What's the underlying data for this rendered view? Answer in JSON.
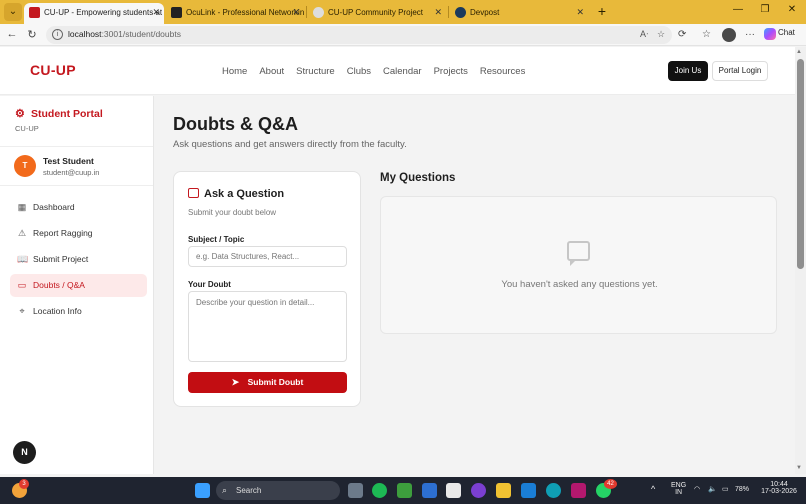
{
  "browser": {
    "tabs": [
      {
        "title": "CU-UP - Empowering students at C",
        "active": true
      },
      {
        "title": "OcuLink - Professional Networking",
        "active": false
      },
      {
        "title": "CU-UP Community Project",
        "active": false
      },
      {
        "title": "Devpost",
        "active": false
      }
    ],
    "url_host": "localhost",
    "url_path": ":3001/student/doubts",
    "chat_label": "Chat"
  },
  "site": {
    "brand": "CU-UP",
    "nav": [
      "Home",
      "About",
      "Structure",
      "Clubs",
      "Calendar",
      "Projects",
      "Resources"
    ],
    "join_label": "Join Us",
    "portal_login_label": "Portal Login"
  },
  "sidebar": {
    "title": "Student Portal",
    "subtitle": "CU-UP",
    "user": {
      "initial": "T",
      "name": "Test Student",
      "email": "student@cuup.in"
    },
    "items": [
      {
        "label": "Dashboard",
        "icon": "grid-icon"
      },
      {
        "label": "Report Ragging",
        "icon": "warning-icon"
      },
      {
        "label": "Submit Project",
        "icon": "book-icon"
      },
      {
        "label": "Doubts / Q&A",
        "icon": "chat-icon",
        "active": true
      },
      {
        "label": "Location Info",
        "icon": "location-pin-icon"
      }
    ]
  },
  "main": {
    "title": "Doubts & Q&A",
    "subtitle": "Ask questions and get answers directly from the faculty.",
    "ask": {
      "title": "Ask a Question",
      "subtitle": "Submit your doubt below",
      "subject_label": "Subject / Topic",
      "subject_placeholder": "e.g. Data Structures, React...",
      "doubt_label": "Your Doubt",
      "doubt_placeholder": "Describe your question in detail...",
      "submit_label": "Submit Doubt"
    },
    "my_questions": {
      "title": "My Questions",
      "empty_text": "You haven't asked any questions yet."
    }
  },
  "floating_badge": "N",
  "taskbar": {
    "search_label": "Search",
    "lang": "ENG",
    "region": "IN",
    "battery": "78%",
    "time": "10:44",
    "date": "17-03-2026",
    "notif_count": "3",
    "whatsapp_count": "42"
  },
  "colors": {
    "brand_red": "#c4181f",
    "tabbar": "#e8b93a",
    "active_item_bg": "#fde9e9"
  }
}
